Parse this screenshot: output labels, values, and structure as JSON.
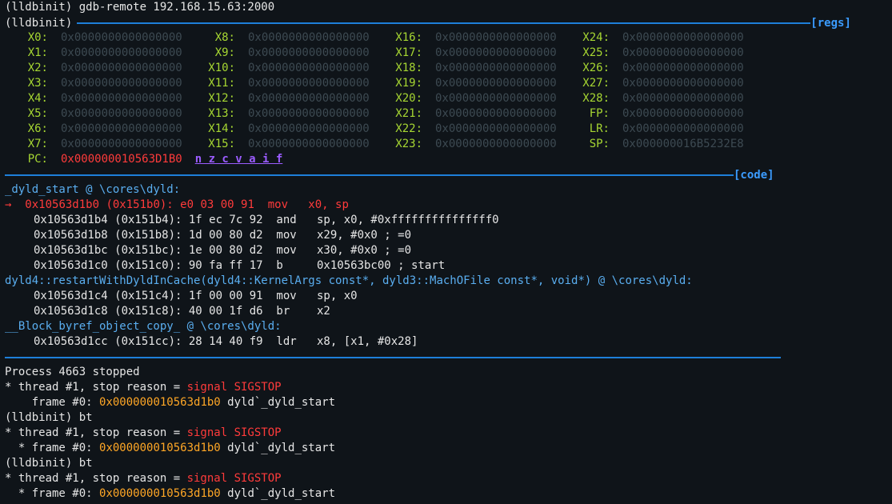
{
  "header": {
    "cmd_line": "(lldbinit) gdb-remote 192.168.15.63:2000",
    "prompt": "(lldbinit)",
    "regs_tag": "[regs]",
    "code_tag": "[code]"
  },
  "regs": {
    "zero_value": "0x0000000000000000",
    "rows": [
      [
        {
          "n": "X0:",
          "v": "0x0000000000000000"
        },
        {
          "n": "X8:",
          "v": "0x0000000000000000"
        },
        {
          "n": "X16:",
          "v": "0x0000000000000000"
        },
        {
          "n": "X24:",
          "v": "0x0000000000000000"
        }
      ],
      [
        {
          "n": "X1:",
          "v": "0x0000000000000000"
        },
        {
          "n": "X9:",
          "v": "0x0000000000000000"
        },
        {
          "n": "X17:",
          "v": "0x0000000000000000"
        },
        {
          "n": "X25:",
          "v": "0x0000000000000000"
        }
      ],
      [
        {
          "n": "X2:",
          "v": "0x0000000000000000"
        },
        {
          "n": "X10:",
          "v": "0x0000000000000000"
        },
        {
          "n": "X18:",
          "v": "0x0000000000000000"
        },
        {
          "n": "X26:",
          "v": "0x0000000000000000"
        }
      ],
      [
        {
          "n": "X3:",
          "v": "0x0000000000000000"
        },
        {
          "n": "X11:",
          "v": "0x0000000000000000"
        },
        {
          "n": "X19:",
          "v": "0x0000000000000000"
        },
        {
          "n": "X27:",
          "v": "0x0000000000000000"
        }
      ],
      [
        {
          "n": "X4:",
          "v": "0x0000000000000000"
        },
        {
          "n": "X12:",
          "v": "0x0000000000000000"
        },
        {
          "n": "X20:",
          "v": "0x0000000000000000"
        },
        {
          "n": "X28:",
          "v": "0x0000000000000000"
        }
      ],
      [
        {
          "n": "X5:",
          "v": "0x0000000000000000"
        },
        {
          "n": "X13:",
          "v": "0x0000000000000000"
        },
        {
          "n": "X21:",
          "v": "0x0000000000000000"
        },
        {
          "n": "FP:",
          "v": "0x0000000000000000"
        }
      ],
      [
        {
          "n": "X6:",
          "v": "0x0000000000000000"
        },
        {
          "n": "X14:",
          "v": "0x0000000000000000"
        },
        {
          "n": "X22:",
          "v": "0x0000000000000000"
        },
        {
          "n": "LR:",
          "v": "0x0000000000000000"
        }
      ],
      [
        {
          "n": "X7:",
          "v": "0x0000000000000000"
        },
        {
          "n": "X15:",
          "v": "0x0000000000000000"
        },
        {
          "n": "X23:",
          "v": "0x0000000000000000"
        },
        {
          "n": "SP:",
          "v": "0x000000016B5232E8",
          "hl": true
        }
      ]
    ],
    "pc_name": "PC:",
    "pc_value": "0x000000010563D1B0",
    "flags": "n z c v a i f"
  },
  "code": {
    "func1": "_dyld_start @ \\cores\\dyld:",
    "arrow": "→",
    "cur_line": "0x10563d1b0 (0x151b0): e0 03 00 91  mov   x0, sp",
    "lines1": [
      "0x10563d1b4 (0x151b4): 1f ec 7c 92  and   sp, x0, #0xfffffffffffffff0",
      "0x10563d1b8 (0x151b8): 1d 00 80 d2  mov   x29, #0x0 ; =0",
      "0x10563d1bc (0x151bc): 1e 00 80 d2  mov   x30, #0x0 ; =0",
      "0x10563d1c0 (0x151c0): 90 fa ff 17  b     0x10563bc00 ; start"
    ],
    "func2": "dyld4::restartWithDyldInCache(dyld4::KernelArgs const*, dyld3::MachOFile const*, void*) @ \\cores\\dyld:",
    "lines2": [
      "0x10563d1c4 (0x151c4): 1f 00 00 91  mov   sp, x0",
      "0x10563d1c8 (0x151c8): 40 00 1f d6  br    x2"
    ],
    "func3": "__Block_byref_object_copy_ @ \\cores\\dyld:",
    "lines3": [
      "0x10563d1cc (0x151cc): 28 14 40 f9  ldr   x8, [x1, #0x28]"
    ]
  },
  "console": {
    "process": "Process 4663 stopped",
    "thread_prefix": "* thread #1, stop reason = ",
    "signal": "signal SIGSTOP",
    "frame_prefix1": "    frame #0: ",
    "frame_prefix2": "  * frame #0: ",
    "frame_addr": "0x000000010563d1b0",
    "frame_sym": " dyld`_dyld_start",
    "bt_cmd": "(lldbinit) bt"
  }
}
